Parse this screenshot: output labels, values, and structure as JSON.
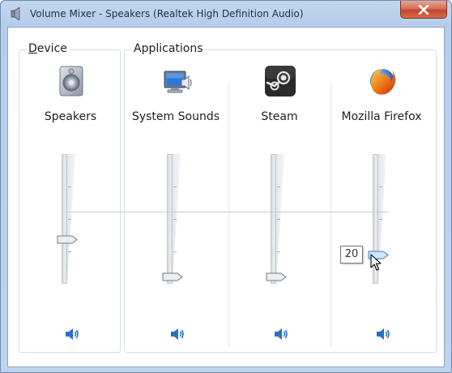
{
  "window": {
    "title": "Volume Mixer - Speakers (Realtek High Definition Audio)",
    "accent": "#c3d7ee",
    "close_button_color": "#c3452c"
  },
  "device_group": {
    "label": "Device",
    "underlined_letter": "D",
    "label_rest": "evice",
    "items": [
      {
        "name": "Speakers",
        "icon": "speaker-device-icon",
        "volume_percent": 33,
        "muted": false
      }
    ]
  },
  "applications_group": {
    "label": "Applications",
    "items": [
      {
        "name": "System Sounds",
        "icon": "system-sounds-icon",
        "volume_percent": 2,
        "muted": false
      },
      {
        "name": "Steam",
        "icon": "steam-icon",
        "volume_percent": 2,
        "muted": false
      },
      {
        "name": "Mozilla Firefox",
        "icon": "firefox-icon",
        "volume_percent": 20,
        "muted": false
      }
    ]
  },
  "tooltip": {
    "value": "20"
  }
}
